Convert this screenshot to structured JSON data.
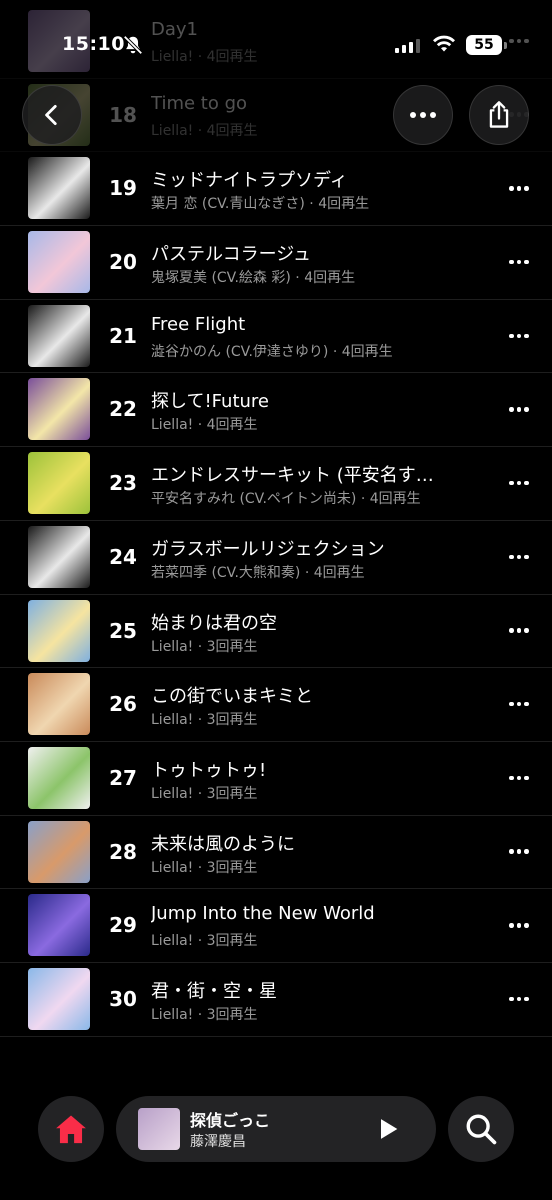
{
  "status_bar": {
    "time": "15:10",
    "battery": "55"
  },
  "colors": {
    "accent": "#fa2d48",
    "background": "#000000",
    "secondary_text": "#9a9a9a"
  },
  "tracks": [
    {
      "num": "",
      "title": "Day1",
      "artist": "Liella!",
      "plays": "4回再生",
      "colors": [
        "#8b6fa8",
        "#d9c2e8"
      ]
    },
    {
      "num": "18",
      "title": "Time to go",
      "artist": "Liella!",
      "plays": "4回再生",
      "colors": [
        "#6e8e4a",
        "#d8d29a"
      ]
    },
    {
      "num": "19",
      "title": "ミッドナイトラプソディ",
      "artist": "葉月 恋 (CV.青山なぎさ)",
      "plays": "4回再生",
      "colors": [
        "#1a1a1a",
        "#e8e8e8"
      ]
    },
    {
      "num": "20",
      "title": "パステルコラージュ",
      "artist": "鬼塚夏美 (CV.絵森 彩)",
      "plays": "4回再生",
      "colors": [
        "#a7b8e8",
        "#f2c7d8"
      ]
    },
    {
      "num": "21",
      "title": "Free Flight",
      "artist": "澁谷かのん (CV.伊達さゆり)",
      "plays": "4回再生",
      "colors": [
        "#1a1a1a",
        "#e8e8e8"
      ]
    },
    {
      "num": "22",
      "title": "探して!Future",
      "artist": "Liella!",
      "plays": "4回再生",
      "colors": [
        "#7a4e9a",
        "#f3e6a8"
      ]
    },
    {
      "num": "23",
      "title": "エンドレスサーキット (平安名す…",
      "artist": "平安名すみれ (CV.ペイトン尚未)",
      "plays": "4回再生",
      "colors": [
        "#9cc23a",
        "#e8e060"
      ]
    },
    {
      "num": "24",
      "title": "ガラスボールリジェクション",
      "artist": "若菜四季 (CV.大熊和奏)",
      "plays": "4回再生",
      "colors": [
        "#1a1a1a",
        "#e8e8e8"
      ]
    },
    {
      "num": "25",
      "title": "始まりは君の空",
      "artist": "Liella!",
      "plays": "3回再生",
      "colors": [
        "#7fb0e0",
        "#f6e4a0"
      ]
    },
    {
      "num": "26",
      "title": "この街でいまキミと",
      "artist": "Liella!",
      "plays": "3回再生",
      "colors": [
        "#c98a5a",
        "#f0d6b0"
      ]
    },
    {
      "num": "27",
      "title": "トゥトゥトゥ!",
      "artist": "Liella!",
      "plays": "3回再生",
      "colors": [
        "#f0f0f0",
        "#8cc46a"
      ]
    },
    {
      "num": "28",
      "title": "未来は風のように",
      "artist": "Liella!",
      "plays": "3回再生",
      "colors": [
        "#8aa0c8",
        "#d89a6a"
      ]
    },
    {
      "num": "29",
      "title": "Jump Into the New World",
      "artist": "Liella!",
      "plays": "3回再生",
      "colors": [
        "#2a2a8a",
        "#8a6ae0"
      ]
    },
    {
      "num": "30",
      "title": "君・街・空・星",
      "artist": "Liella!",
      "plays": "3回再生",
      "colors": [
        "#8ab8e8",
        "#f0d8f0"
      ]
    }
  ],
  "now_playing": {
    "title": "探偵ごっこ",
    "artist": "藤澤慶昌",
    "colors": [
      "#b8a0c8",
      "#e8d8e8"
    ]
  },
  "icons": {
    "back": "chevron-left-icon",
    "more": "ellipsis-icon",
    "share": "share-icon",
    "home": "home-icon",
    "play": "play-icon",
    "search": "search-icon"
  }
}
